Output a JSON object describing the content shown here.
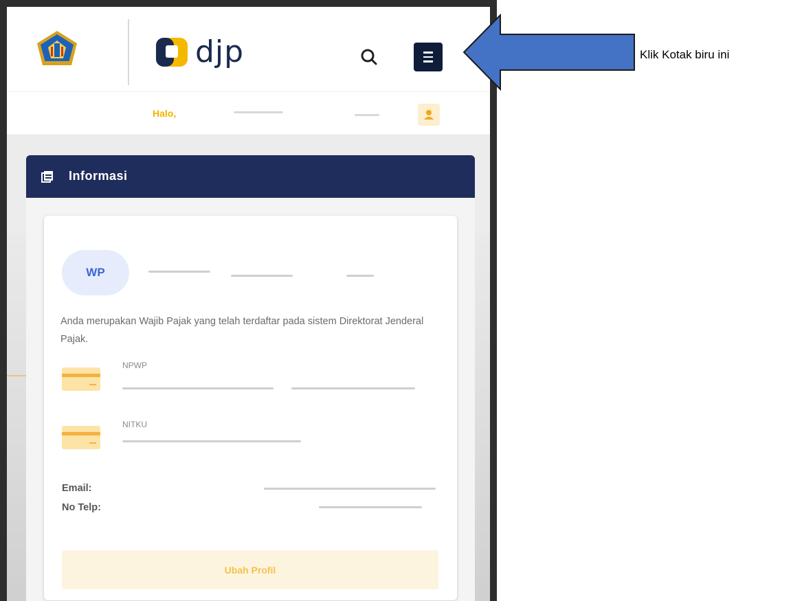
{
  "header": {
    "logo_text": "djp",
    "search_icon": "search-icon",
    "menu_icon": "hamburger-menu-icon"
  },
  "greeting": {
    "label": "Halo,",
    "avatar_icon": "user-icon",
    "accent": "#f2b400"
  },
  "panel": {
    "title": "Informasi",
    "header_color": "#1f2d5c"
  },
  "profile": {
    "avatar_initials": "WP",
    "description": "Anda merupakan Wajib Pajak yang telah terdaftar pada sistem Direktorat Jenderal Pajak.",
    "npwp_label": "NPWP",
    "nitku_label": "NITKU",
    "email_label": "Email:",
    "phone_label": "No Telp:",
    "edit_button": "Ubah Profil"
  },
  "annotation": {
    "arrow_color": "#4472c4",
    "callout_text": "Klik Kotak biru ini"
  }
}
